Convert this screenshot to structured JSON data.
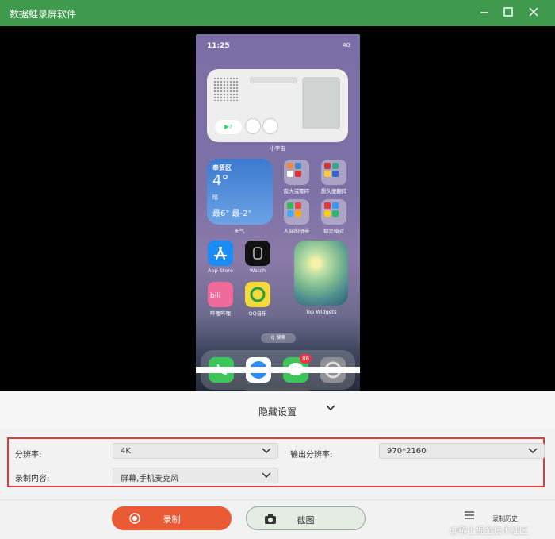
{
  "window": {
    "title": "数据蛙录屏软件"
  },
  "phone": {
    "status": {
      "time": "11:25",
      "signal": "4G"
    },
    "widgets": {
      "radio_label": "小宇宙",
      "weather": {
        "location": "奉贤区",
        "temp": "4°",
        "condition": "晴",
        "range": "最6° 最-2°",
        "label": "天气"
      }
    },
    "folders": [
      {
        "label": "庞大或零碎"
      },
      {
        "label": "想久便翻阵"
      },
      {
        "label": "人间的纽带"
      },
      {
        "label": "都是暗对"
      }
    ],
    "apps": [
      {
        "label": "App Store"
      },
      {
        "label": "Watch"
      },
      {
        "label": "哔哩哔哩"
      },
      {
        "label": "QQ音乐"
      },
      {
        "label": "Top Widgets"
      }
    ],
    "search_label": "Q 搜索",
    "dock_badge": "86"
  },
  "panel": {
    "hide_settings": "隐藏设置",
    "resolution_label": "分辨率:",
    "resolution_value": "4K",
    "output_resolution_label": "输出分辨率:",
    "output_resolution_value": "970*2160",
    "record_content_label": "录制内容:",
    "record_content_value": "屏幕,手机麦克风",
    "record_button": "录制",
    "screenshot_button": "截图",
    "history_label": "录制历史"
  },
  "watermark": "@稀土掘金技术社区",
  "colors": {
    "titlebar": "#3f9a4d",
    "record": "#ea5a34",
    "highlight": "#e03a3a"
  }
}
